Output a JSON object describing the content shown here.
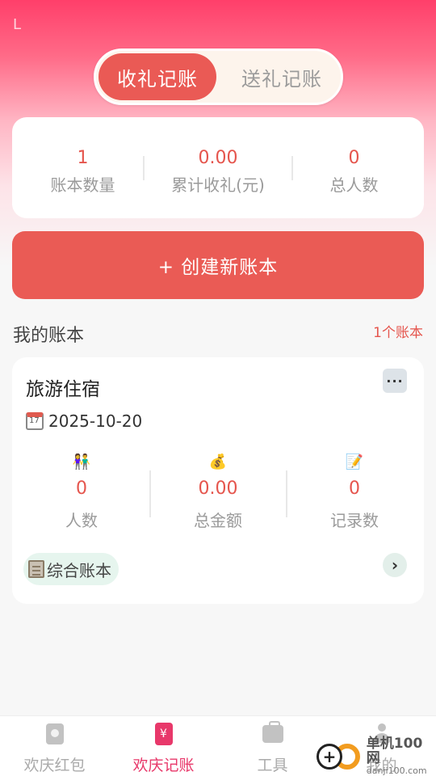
{
  "status": {
    "indicator": "L"
  },
  "segment": {
    "active_label": "收礼记账",
    "inactive_label": "送礼记账"
  },
  "summary": {
    "book_count_value": "1",
    "book_count_label": "账本数量",
    "total_gift_value": "0.00",
    "total_gift_label": "累计收礼(元)",
    "people_value": "0",
    "people_label": "总人数"
  },
  "create_button": {
    "label": "+ 创建新账本"
  },
  "section": {
    "title": "我的账本",
    "count": "1个账本"
  },
  "book": {
    "name": "旅游住宿",
    "more": "···",
    "date": "2025-10-20",
    "stats": [
      {
        "icon": "👫",
        "value": "0",
        "label": "人数"
      },
      {
        "icon": "💰",
        "value": "0.00",
        "label": "总金额"
      },
      {
        "icon": "📝",
        "value": "0",
        "label": "记录数"
      }
    ],
    "tag": "综合账本",
    "arrow": "›"
  },
  "tabbar": {
    "tabs": [
      {
        "label": "欢庆红包",
        "icon": "red-envelope-icon"
      },
      {
        "label": "欢庆记账",
        "icon": "ledger-icon",
        "glyph": "¥"
      },
      {
        "label": "工具",
        "icon": "toolbox-icon"
      },
      {
        "label": "我的",
        "icon": "user-icon"
      }
    ],
    "active_index": 1
  },
  "watermark": {
    "brand": "单机100网",
    "domain": "danji100.com",
    "mark": "+"
  },
  "colors": {
    "accent": "#ea5a55",
    "value_red": "#e5554d",
    "tab_active": "#e8386a",
    "header_pink": "#ff3f6a"
  }
}
